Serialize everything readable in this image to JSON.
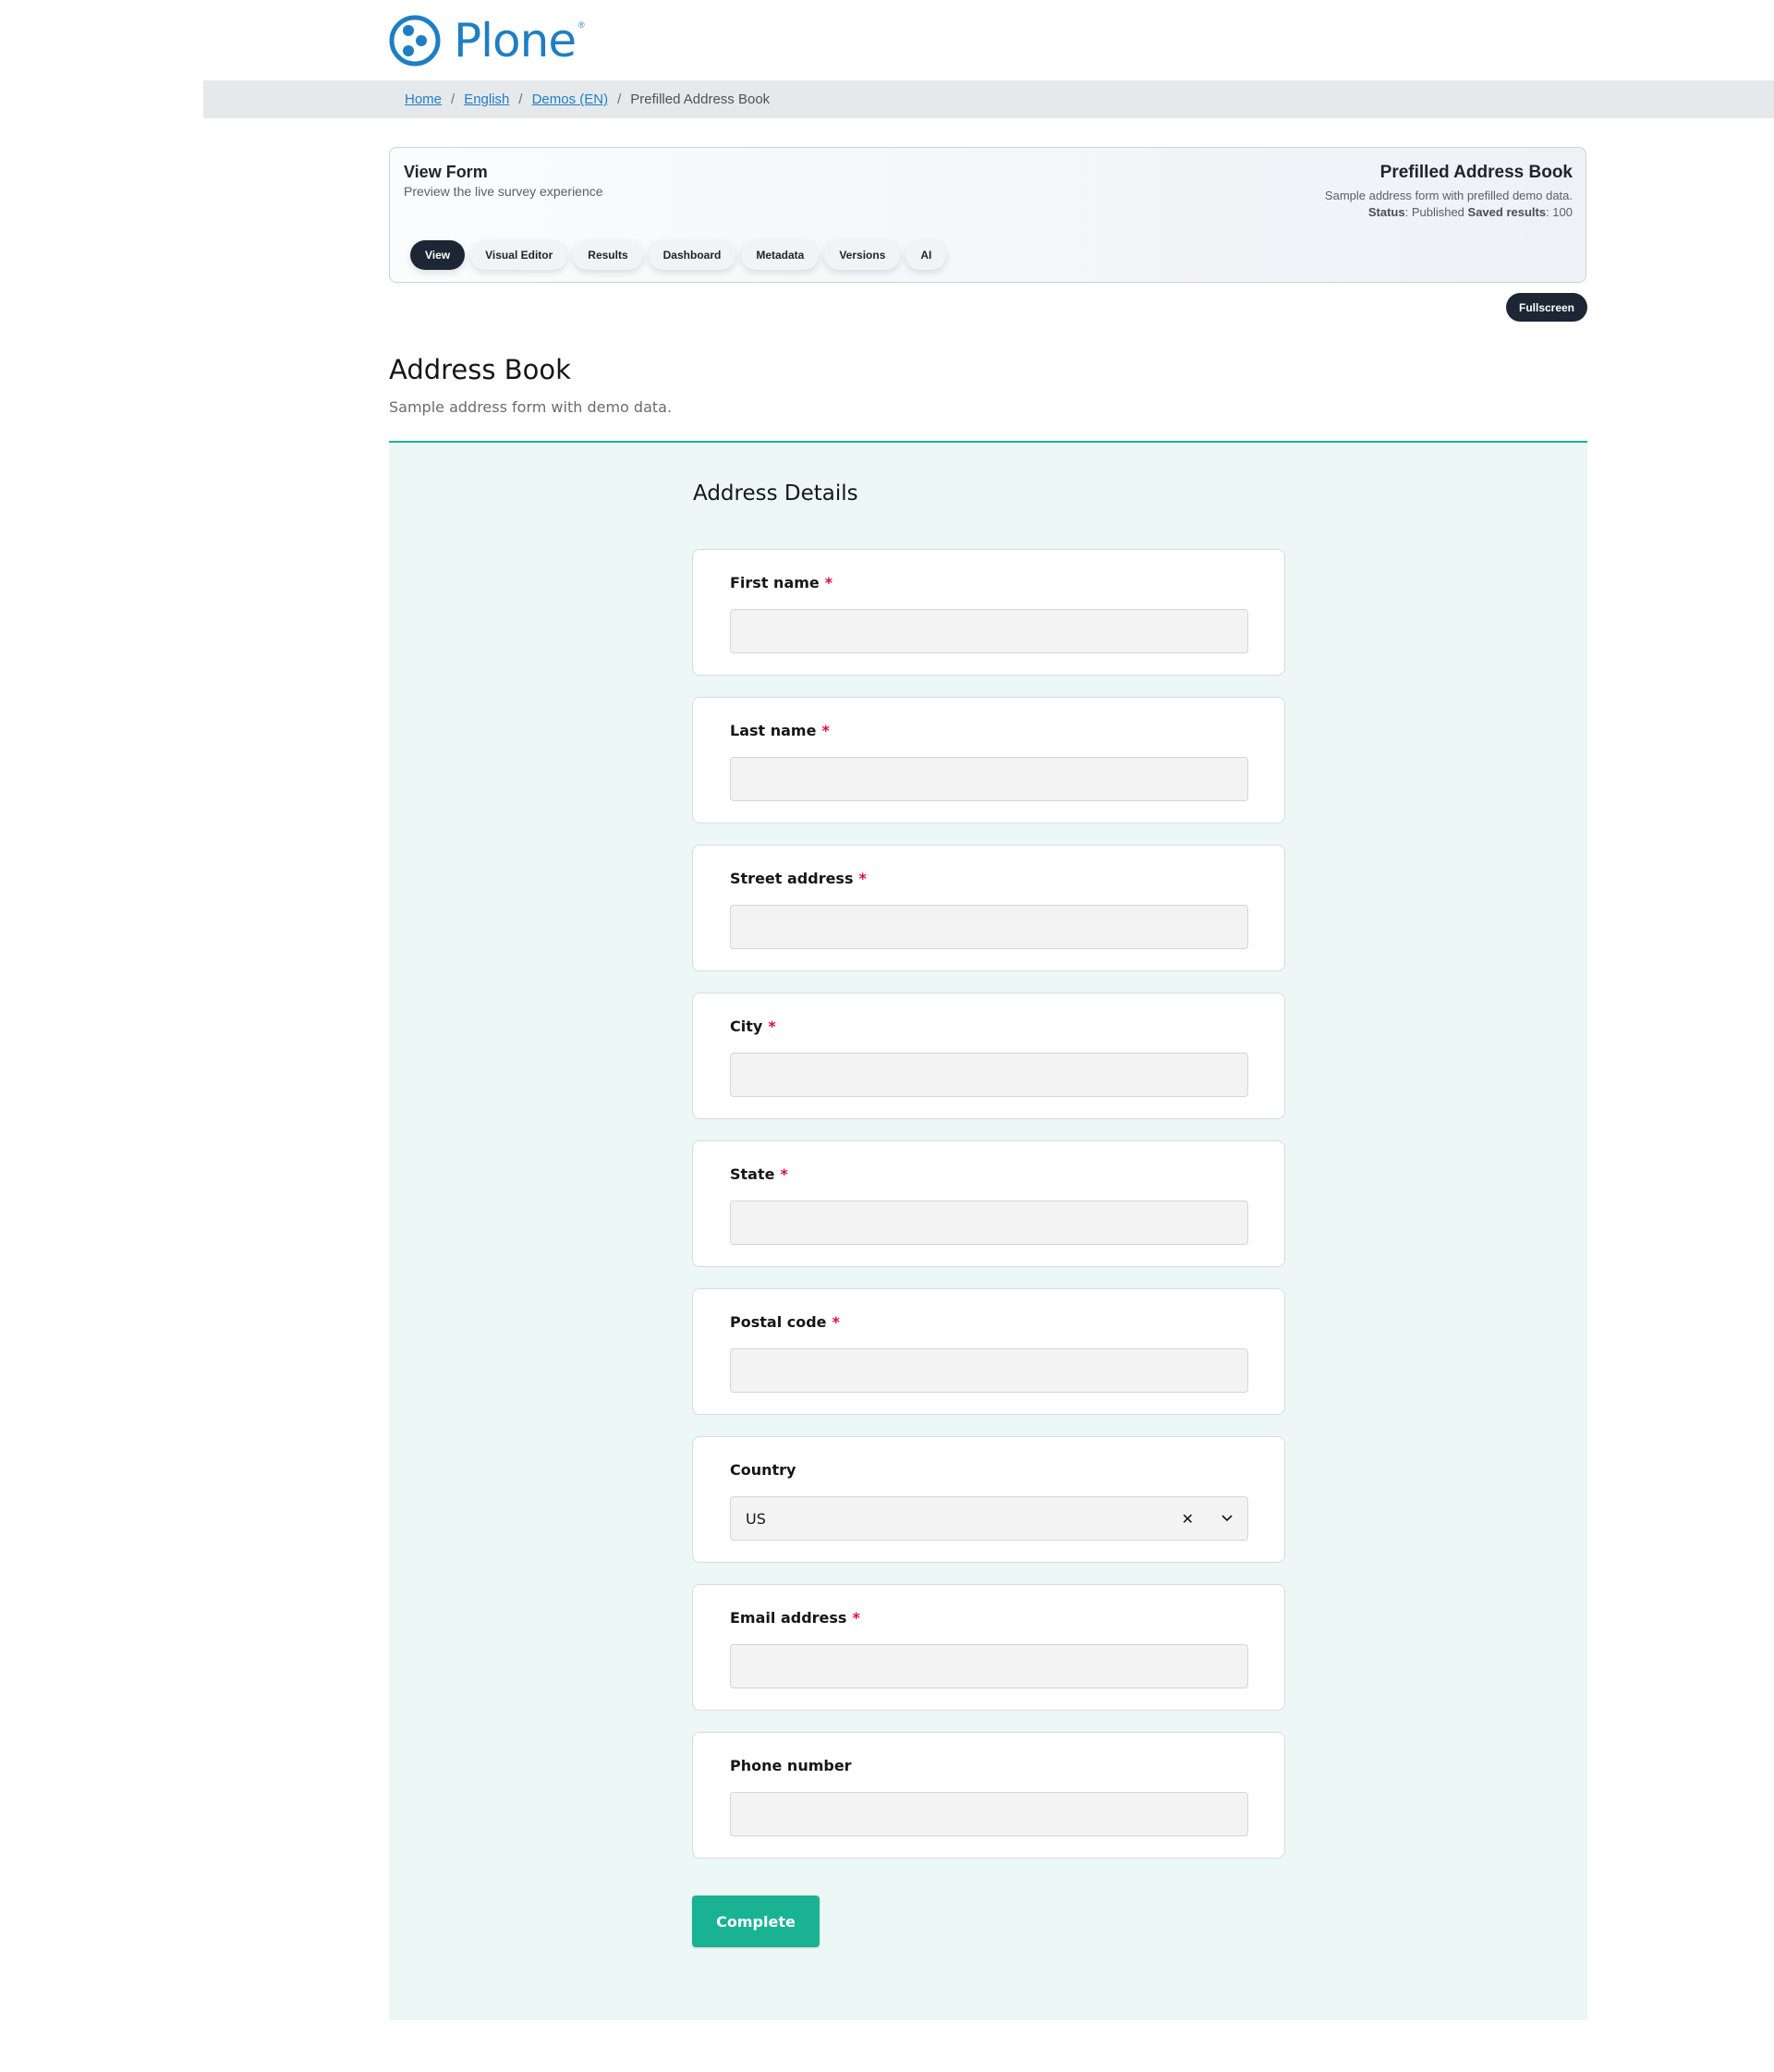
{
  "logo": {
    "text": "Plone",
    "reg": "®"
  },
  "breadcrumb": {
    "items": [
      {
        "label": "Home",
        "link": true
      },
      {
        "label": "English",
        "link": true
      },
      {
        "label": "Demos (EN)",
        "link": true
      },
      {
        "label": "Prefilled Address Book",
        "link": false
      }
    ],
    "separator": "/"
  },
  "panel": {
    "title": "View Form",
    "subtitle": "Preview the live survey experience",
    "right_title": "Prefilled Address Book",
    "right_desc": "Sample address form with prefilled demo data.",
    "status_label": "Status",
    "status_value": ": Published ",
    "saved_label": "Saved results",
    "saved_value": ": 100",
    "tabs": [
      "View",
      "Visual Editor",
      "Results",
      "Dashboard",
      "Metadata",
      "Versions",
      "AI"
    ],
    "active_tab": "View"
  },
  "fullscreen_label": "Fullscreen",
  "survey": {
    "title": "Address Book",
    "description": "Sample address form with demo data.",
    "page_title": "Address Details",
    "questions": [
      {
        "label": "First name",
        "required": true,
        "value": ""
      },
      {
        "label": "Last name",
        "required": true,
        "value": ""
      },
      {
        "label": "Street address",
        "required": true,
        "value": ""
      },
      {
        "label": "City",
        "required": true,
        "value": ""
      },
      {
        "label": "State",
        "required": true,
        "value": ""
      },
      {
        "label": "Postal code",
        "required": true,
        "value": ""
      },
      {
        "label": "Country",
        "required": false,
        "value": "US",
        "type": "dropdown"
      },
      {
        "label": "Email address",
        "required": true,
        "value": ""
      },
      {
        "label": "Phone number",
        "required": false,
        "value": ""
      }
    ],
    "required_mark": "*",
    "complete_label": "Complete"
  },
  "colors": {
    "brand": "#1f7ec3",
    "accent": "#19b394",
    "dark_pill": "#1c2634",
    "required": "#e50a3e"
  }
}
